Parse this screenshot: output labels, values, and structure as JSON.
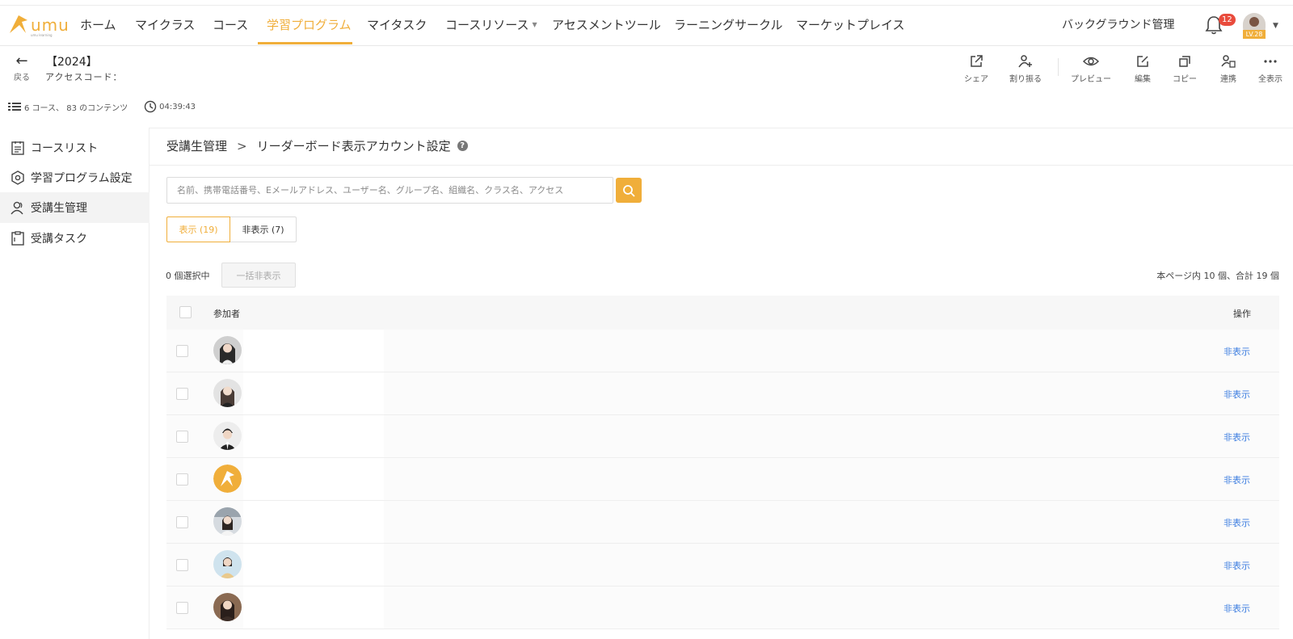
{
  "brand": {
    "name": "umu",
    "tagline": "umu learning"
  },
  "nav": {
    "items": [
      {
        "label": "ホーム"
      },
      {
        "label": "マイクラス"
      },
      {
        "label": "コース"
      },
      {
        "label": "学習プログラム"
      },
      {
        "label": "マイタスク"
      },
      {
        "label": "コースリソース"
      },
      {
        "label": "アセスメントツール"
      },
      {
        "label": "ラーニングサークル"
      },
      {
        "label": "マーケットプレイス"
      }
    ],
    "background_mgmt": "バックグラウンド管理",
    "notification_count": "12",
    "level": "LV.28"
  },
  "header": {
    "back_label": "戻る",
    "title": "【2024】",
    "access_code": "アクセスコード："
  },
  "toolbar": [
    {
      "label": "シェア",
      "icon": "share-icon"
    },
    {
      "label": "割り振る",
      "icon": "assign-user-icon"
    },
    {
      "label": "プレビュー",
      "icon": "eye-icon"
    },
    {
      "label": "編集",
      "icon": "edit-icon"
    },
    {
      "label": "コピー",
      "icon": "copy-icon"
    },
    {
      "label": "連携",
      "icon": "link-user-icon"
    },
    {
      "label": "全表示",
      "icon": "more-icon"
    }
  ],
  "meta": {
    "courses": "6 コース、 83 のコンテンツ",
    "duration": "04:39:43"
  },
  "sidebar": {
    "items": [
      {
        "label": "コースリスト",
        "icon": "list-icon"
      },
      {
        "label": "学習プログラム設定",
        "icon": "settings-icon"
      },
      {
        "label": "受講生管理",
        "icon": "user-icon"
      },
      {
        "label": "受講タスク",
        "icon": "clipboard-icon"
      }
    ]
  },
  "breadcrumb": {
    "parent": "受講生管理",
    "separator": ">",
    "current": "リーダーボード表示アカウント設定"
  },
  "search": {
    "placeholder": "名前、携帯電話番号、Eメールアドレス、ユーザー名、グループ名、組織名、クラス名、アクセス"
  },
  "tabs": {
    "shown": "表示 (19)",
    "hidden": "非表示 (7)"
  },
  "selection": {
    "count": "0 個選択中",
    "bulk_hide": "一括非表示",
    "page_info": "本ページ内 10 個、合計 19 個"
  },
  "table": {
    "col_participant": "参加者",
    "col_action": "操作",
    "rows": [
      {
        "action": "非表示"
      },
      {
        "action": "非表示"
      },
      {
        "action": "非表示"
      },
      {
        "action": "非表示"
      },
      {
        "action": "非表示"
      },
      {
        "action": "非表示"
      },
      {
        "action": "非表示"
      }
    ]
  },
  "colors": {
    "accent": "#f0ae3a",
    "link": "#3d7ee0",
    "badge": "#e94b3c"
  }
}
